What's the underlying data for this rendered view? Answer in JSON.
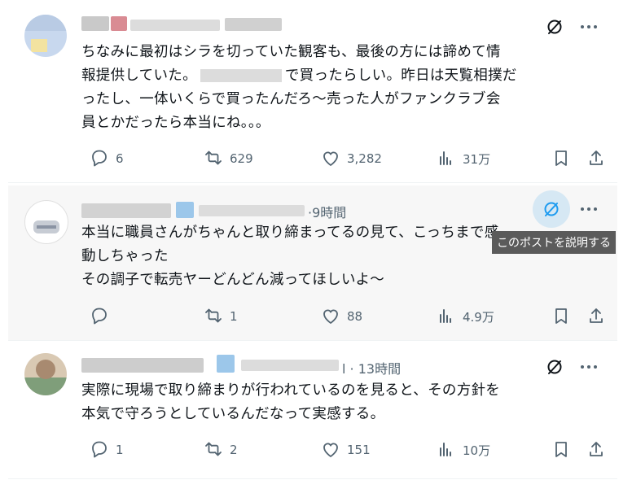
{
  "posts": [
    {
      "time": "",
      "text_lines": [
        "ちなみに最初はシラを切っていた観客も、最後の方には諦めて情",
        "報提供していた。",
        "で買ったらしい。昨日は天覧相撲だ",
        "ったし、一体いくらで買ったんだろ～売った人がファンクラブ会",
        "員とかだったら本当にね。。。"
      ],
      "replies": "6",
      "reposts": "629",
      "likes": "3,282",
      "views": "31万"
    },
    {
      "time": "·9時間",
      "text_lines": [
        "本当に職員さんがちゃんと取り締まってるの見て、こっちまで感",
        "動しちゃった",
        "その調子で転売ヤーどんどん減ってほしいよ～"
      ],
      "replies": "",
      "reposts": "1",
      "likes": "88",
      "views": "4.9万"
    },
    {
      "time": "l · 13時間",
      "text_lines": [
        "実際に現場で取り締まりが行われているのを見ると、その方針を",
        "本気で守ろうとしているんだなって実感する。"
      ],
      "replies": "1",
      "reposts": "2",
      "likes": "151",
      "views": "10万"
    }
  ],
  "tooltip": "このポストを説明する",
  "icons": {
    "reply": "reply-icon",
    "repost": "repost-icon",
    "like": "heart-icon",
    "views": "views-icon",
    "bookmark": "bookmark-icon",
    "share": "share-icon",
    "grok": "grok-icon",
    "more": "more-icon"
  },
  "colors": {
    "text": "#0f1419",
    "muted": "#536471",
    "grok_active_bg": "#d6e8f4",
    "grok_active": "#1d9bf0"
  }
}
